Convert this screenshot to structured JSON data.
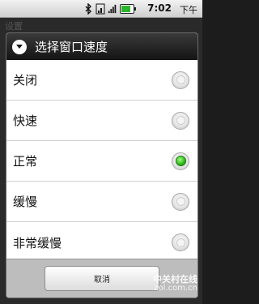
{
  "status_bar": {
    "time": "7:02",
    "ampm": "下午",
    "icons": [
      "bluetooth-icon",
      "wifi-icon",
      "signal-icon",
      "battery-icon"
    ],
    "battery_color": "#2db52d"
  },
  "background": {
    "label": "设置"
  },
  "dialog": {
    "title": "选择窗口速度",
    "title_icon": "chevron-down-icon",
    "options": [
      {
        "label": "关闭",
        "selected": false
      },
      {
        "label": "快速",
        "selected": false
      },
      {
        "label": "正常",
        "selected": true
      },
      {
        "label": "缓慢",
        "selected": false
      },
      {
        "label": "非常缓慢",
        "selected": false
      }
    ],
    "cancel_label": "取消",
    "selected_color": "#21a812"
  },
  "watermark": {
    "line1": "中关村在线",
    "line2": "zol.com.cn"
  }
}
